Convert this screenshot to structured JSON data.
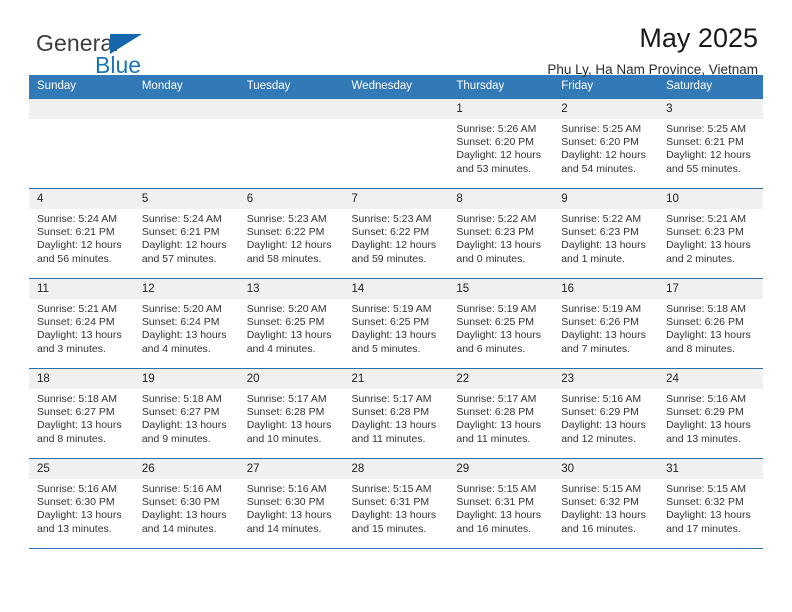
{
  "logo": {
    "word_one": "General",
    "word_two": "Blue",
    "triangle_color": "#1566ab",
    "blue_color": "#1b75bb"
  },
  "header": {
    "month_title": "May 2025",
    "location": "Phu Ly, Ha Nam Province, Vietnam"
  },
  "theme": {
    "header_blue": "#3279b7",
    "rule_blue": "#2f6fa8",
    "daynum_bg": "#f0f0f0"
  },
  "weekday_headers": [
    "Sunday",
    "Monday",
    "Tuesday",
    "Wednesday",
    "Thursday",
    "Friday",
    "Saturday"
  ],
  "weeks": [
    [
      {
        "day": "",
        "sunrise": "",
        "sunset": "",
        "daylight_1": "",
        "daylight_2": ""
      },
      {
        "day": "",
        "sunrise": "",
        "sunset": "",
        "daylight_1": "",
        "daylight_2": ""
      },
      {
        "day": "",
        "sunrise": "",
        "sunset": "",
        "daylight_1": "",
        "daylight_2": ""
      },
      {
        "day": "",
        "sunrise": "",
        "sunset": "",
        "daylight_1": "",
        "daylight_2": ""
      },
      {
        "day": "1",
        "sunrise": "Sunrise: 5:26 AM",
        "sunset": "Sunset: 6:20 PM",
        "daylight_1": "Daylight: 12 hours",
        "daylight_2": "and 53 minutes."
      },
      {
        "day": "2",
        "sunrise": "Sunrise: 5:25 AM",
        "sunset": "Sunset: 6:20 PM",
        "daylight_1": "Daylight: 12 hours",
        "daylight_2": "and 54 minutes."
      },
      {
        "day": "3",
        "sunrise": "Sunrise: 5:25 AM",
        "sunset": "Sunset: 6:21 PM",
        "daylight_1": "Daylight: 12 hours",
        "daylight_2": "and 55 minutes."
      }
    ],
    [
      {
        "day": "4",
        "sunrise": "Sunrise: 5:24 AM",
        "sunset": "Sunset: 6:21 PM",
        "daylight_1": "Daylight: 12 hours",
        "daylight_2": "and 56 minutes."
      },
      {
        "day": "5",
        "sunrise": "Sunrise: 5:24 AM",
        "sunset": "Sunset: 6:21 PM",
        "daylight_1": "Daylight: 12 hours",
        "daylight_2": "and 57 minutes."
      },
      {
        "day": "6",
        "sunrise": "Sunrise: 5:23 AM",
        "sunset": "Sunset: 6:22 PM",
        "daylight_1": "Daylight: 12 hours",
        "daylight_2": "and 58 minutes."
      },
      {
        "day": "7",
        "sunrise": "Sunrise: 5:23 AM",
        "sunset": "Sunset: 6:22 PM",
        "daylight_1": "Daylight: 12 hours",
        "daylight_2": "and 59 minutes."
      },
      {
        "day": "8",
        "sunrise": "Sunrise: 5:22 AM",
        "sunset": "Sunset: 6:23 PM",
        "daylight_1": "Daylight: 13 hours",
        "daylight_2": "and 0 minutes."
      },
      {
        "day": "9",
        "sunrise": "Sunrise: 5:22 AM",
        "sunset": "Sunset: 6:23 PM",
        "daylight_1": "Daylight: 13 hours",
        "daylight_2": "and 1 minute."
      },
      {
        "day": "10",
        "sunrise": "Sunrise: 5:21 AM",
        "sunset": "Sunset: 6:23 PM",
        "daylight_1": "Daylight: 13 hours",
        "daylight_2": "and 2 minutes."
      }
    ],
    [
      {
        "day": "11",
        "sunrise": "Sunrise: 5:21 AM",
        "sunset": "Sunset: 6:24 PM",
        "daylight_1": "Daylight: 13 hours",
        "daylight_2": "and 3 minutes."
      },
      {
        "day": "12",
        "sunrise": "Sunrise: 5:20 AM",
        "sunset": "Sunset: 6:24 PM",
        "daylight_1": "Daylight: 13 hours",
        "daylight_2": "and 4 minutes."
      },
      {
        "day": "13",
        "sunrise": "Sunrise: 5:20 AM",
        "sunset": "Sunset: 6:25 PM",
        "daylight_1": "Daylight: 13 hours",
        "daylight_2": "and 4 minutes."
      },
      {
        "day": "14",
        "sunrise": "Sunrise: 5:19 AM",
        "sunset": "Sunset: 6:25 PM",
        "daylight_1": "Daylight: 13 hours",
        "daylight_2": "and 5 minutes."
      },
      {
        "day": "15",
        "sunrise": "Sunrise: 5:19 AM",
        "sunset": "Sunset: 6:25 PM",
        "daylight_1": "Daylight: 13 hours",
        "daylight_2": "and 6 minutes."
      },
      {
        "day": "16",
        "sunrise": "Sunrise: 5:19 AM",
        "sunset": "Sunset: 6:26 PM",
        "daylight_1": "Daylight: 13 hours",
        "daylight_2": "and 7 minutes."
      },
      {
        "day": "17",
        "sunrise": "Sunrise: 5:18 AM",
        "sunset": "Sunset: 6:26 PM",
        "daylight_1": "Daylight: 13 hours",
        "daylight_2": "and 8 minutes."
      }
    ],
    [
      {
        "day": "18",
        "sunrise": "Sunrise: 5:18 AM",
        "sunset": "Sunset: 6:27 PM",
        "daylight_1": "Daylight: 13 hours",
        "daylight_2": "and 8 minutes."
      },
      {
        "day": "19",
        "sunrise": "Sunrise: 5:18 AM",
        "sunset": "Sunset: 6:27 PM",
        "daylight_1": "Daylight: 13 hours",
        "daylight_2": "and 9 minutes."
      },
      {
        "day": "20",
        "sunrise": "Sunrise: 5:17 AM",
        "sunset": "Sunset: 6:28 PM",
        "daylight_1": "Daylight: 13 hours",
        "daylight_2": "and 10 minutes."
      },
      {
        "day": "21",
        "sunrise": "Sunrise: 5:17 AM",
        "sunset": "Sunset: 6:28 PM",
        "daylight_1": "Daylight: 13 hours",
        "daylight_2": "and 11 minutes."
      },
      {
        "day": "22",
        "sunrise": "Sunrise: 5:17 AM",
        "sunset": "Sunset: 6:28 PM",
        "daylight_1": "Daylight: 13 hours",
        "daylight_2": "and 11 minutes."
      },
      {
        "day": "23",
        "sunrise": "Sunrise: 5:16 AM",
        "sunset": "Sunset: 6:29 PM",
        "daylight_1": "Daylight: 13 hours",
        "daylight_2": "and 12 minutes."
      },
      {
        "day": "24",
        "sunrise": "Sunrise: 5:16 AM",
        "sunset": "Sunset: 6:29 PM",
        "daylight_1": "Daylight: 13 hours",
        "daylight_2": "and 13 minutes."
      }
    ],
    [
      {
        "day": "25",
        "sunrise": "Sunrise: 5:16 AM",
        "sunset": "Sunset: 6:30 PM",
        "daylight_1": "Daylight: 13 hours",
        "daylight_2": "and 13 minutes."
      },
      {
        "day": "26",
        "sunrise": "Sunrise: 5:16 AM",
        "sunset": "Sunset: 6:30 PM",
        "daylight_1": "Daylight: 13 hours",
        "daylight_2": "and 14 minutes."
      },
      {
        "day": "27",
        "sunrise": "Sunrise: 5:16 AM",
        "sunset": "Sunset: 6:30 PM",
        "daylight_1": "Daylight: 13 hours",
        "daylight_2": "and 14 minutes."
      },
      {
        "day": "28",
        "sunrise": "Sunrise: 5:15 AM",
        "sunset": "Sunset: 6:31 PM",
        "daylight_1": "Daylight: 13 hours",
        "daylight_2": "and 15 minutes."
      },
      {
        "day": "29",
        "sunrise": "Sunrise: 5:15 AM",
        "sunset": "Sunset: 6:31 PM",
        "daylight_1": "Daylight: 13 hours",
        "daylight_2": "and 16 minutes."
      },
      {
        "day": "30",
        "sunrise": "Sunrise: 5:15 AM",
        "sunset": "Sunset: 6:32 PM",
        "daylight_1": "Daylight: 13 hours",
        "daylight_2": "and 16 minutes."
      },
      {
        "day": "31",
        "sunrise": "Sunrise: 5:15 AM",
        "sunset": "Sunset: 6:32 PM",
        "daylight_1": "Daylight: 13 hours",
        "daylight_2": "and 17 minutes."
      }
    ]
  ]
}
